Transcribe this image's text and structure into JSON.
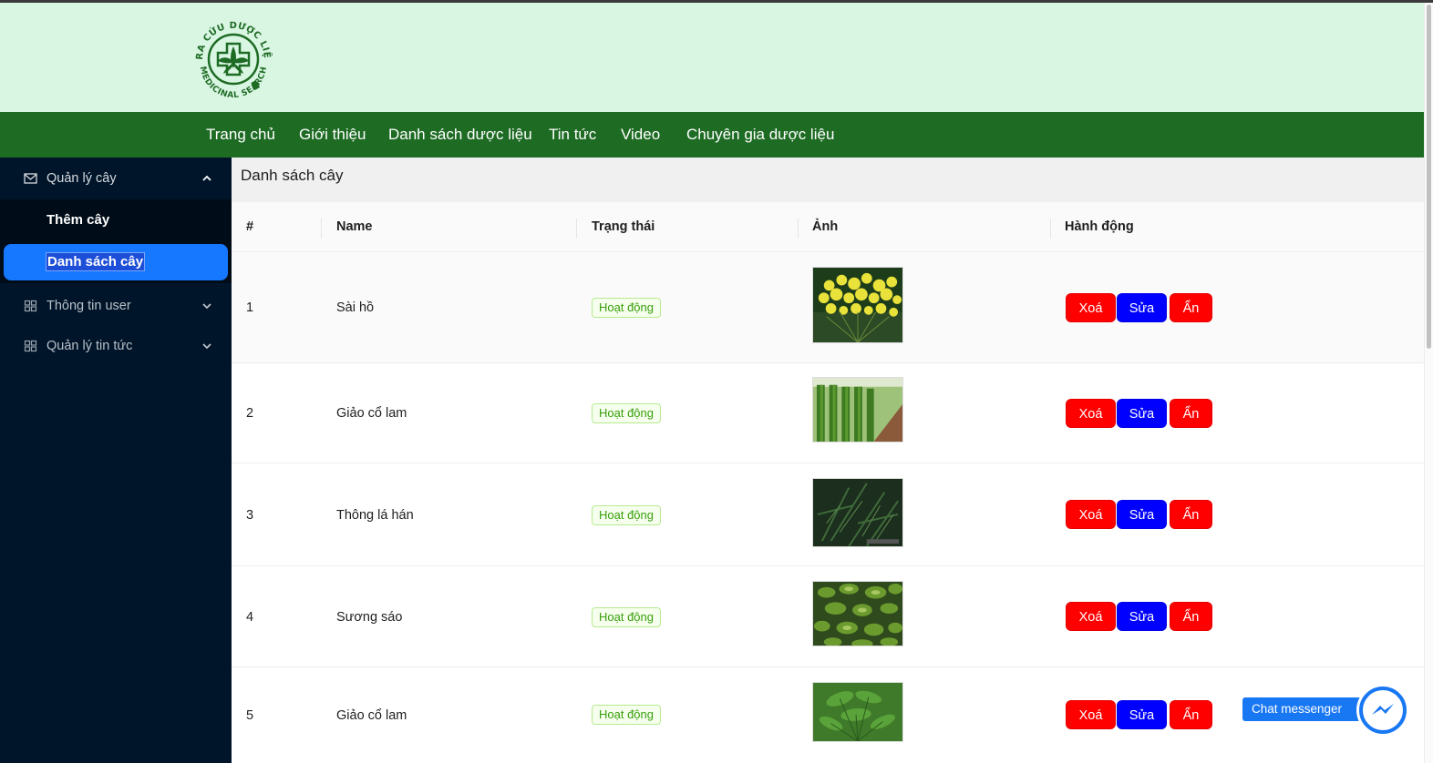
{
  "logo": {
    "ring_text_top": "TRA CỨU DƯỢC LIỆU",
    "ring_text_bottom": "MEDICINAL SEARCH"
  },
  "nav": [
    "Trang chủ",
    "Giới thiệu",
    "Danh sách dược liệu",
    "Tin tức",
    "Video",
    "Chuyên gia dược liệu"
  ],
  "sidebar": {
    "group1": {
      "label": "Quản lý cây",
      "icon": "mail-icon",
      "expanded": true
    },
    "subitems": [
      {
        "label": "Thêm cây",
        "active": false
      },
      {
        "label": "Danh sách cây",
        "active": true
      }
    ],
    "group2": {
      "label": "Thông tin user",
      "icon": "grid-icon"
    },
    "group3": {
      "label": "Quản lý tin tức",
      "icon": "grid-icon"
    }
  },
  "page": {
    "title": "Danh sách cây"
  },
  "table": {
    "headers": [
      "#",
      "Name",
      "Trạng thái",
      "Ảnh",
      "Hành động"
    ],
    "rows": [
      {
        "index": "1",
        "name": "Sài hồ",
        "status": "Hoạt động",
        "image": "yellow-flower-cluster"
      },
      {
        "index": "2",
        "name": "Giảo cổ lam",
        "status": "Hoạt động",
        "image": "vine-rows-field"
      },
      {
        "index": "3",
        "name": "Thông lá hán",
        "status": "Hoạt động",
        "image": "dark-pine-leaves"
      },
      {
        "index": "4",
        "name": "Sương sáo",
        "status": "Hoạt động",
        "image": "green-leaf-bush"
      },
      {
        "index": "5",
        "name": "Giảo cổ lam",
        "status": "Hoạt động",
        "image": "five-leaf-vine"
      }
    ],
    "actions": {
      "delete": "Xoá",
      "edit": "Sửa",
      "hide": "Ẩn"
    }
  },
  "chat": {
    "label": "Chat messenger",
    "icon": "messenger-icon"
  },
  "colors": {
    "header_bg": "#d9f6e3",
    "nav_bg": "#1e6b24",
    "sidebar_bg": "#001529",
    "active_item": "#1677ff",
    "delete_btn": "#ff0000",
    "edit_btn": "#0000ff",
    "status_green": "#389e0d",
    "messenger_blue": "#1877f2"
  }
}
